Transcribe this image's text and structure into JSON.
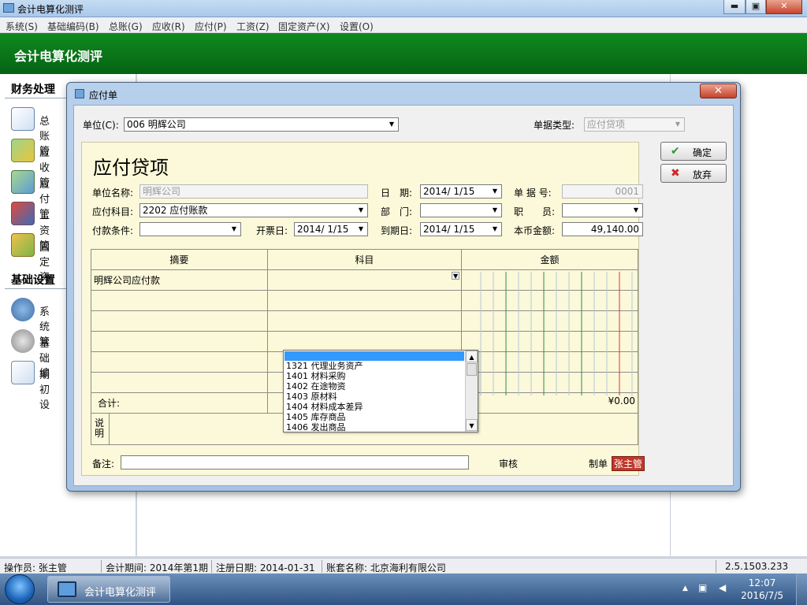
{
  "app": {
    "title": "会计电算化测评",
    "window_buttons": {
      "minimize": "▬",
      "restore": "▣",
      "close": "✕"
    }
  },
  "menu": [
    "系统(S)",
    "基础编码(B)",
    "总账(G)",
    "应收(R)",
    "应付(P)",
    "工资(Z)",
    "固定资产(X)",
    "设置(O)"
  ],
  "banner_title": "会计电算化测评",
  "sidebar": {
    "sections": [
      {
        "title": "财务处理",
        "items": [
          {
            "label": "总账管",
            "icon": "notepad-icon"
          },
          {
            "label": "应收管",
            "icon": "money-coins-icon"
          },
          {
            "label": "应付管",
            "icon": "money-arrows-icon"
          },
          {
            "label": "工资管",
            "icon": "id-card-icon"
          },
          {
            "label": "固定资",
            "icon": "basket-icon"
          }
        ]
      },
      {
        "title": "基础设置",
        "items": [
          {
            "label": "系统管",
            "icon": "gears-icon"
          },
          {
            "label": "基础编",
            "icon": "gear-icon"
          },
          {
            "label": "期初设",
            "icon": "spreadsheet-coins-icon"
          }
        ]
      }
    ]
  },
  "dialog": {
    "title": "应付单",
    "close_label": "✕",
    "unit_label": "单位(C):",
    "unit_value": "006 明辉公司",
    "doc_type_label": "单据类型:",
    "doc_type_value": "应付贷项",
    "confirm_label": "确定",
    "cancel_label": "放弃",
    "voucher": {
      "heading": "应付贷项",
      "fields": {
        "company_name_label": "单位名称:",
        "company_name_value": "明辉公司",
        "date_label": "日　期:",
        "date_value": "2014/ 1/15",
        "doc_no_label": "单 据 号:",
        "doc_no_value": "0001",
        "account_label": "应付科目:",
        "account_value": "2202 应付账款",
        "dept_label": "部　门:",
        "dept_value": "",
        "staff_label": "职　　员:",
        "staff_value": "",
        "payment_terms_label": "付款条件:",
        "payment_terms_value": "",
        "invoice_date_label": "开票日:",
        "invoice_date_value": "2014/ 1/15",
        "due_date_label": "到期日:",
        "due_date_value": "2014/ 1/15",
        "local_amount_label": "本币金额:",
        "local_amount_value": "49,140.00"
      },
      "table": {
        "headers": [
          "摘要",
          "科目",
          "金额"
        ],
        "rows": [
          {
            "summary": "明辉公司应付款",
            "subject": ""
          },
          {
            "summary": "",
            "subject": ""
          },
          {
            "summary": "",
            "subject": ""
          },
          {
            "summary": "",
            "subject": ""
          },
          {
            "summary": "",
            "subject": ""
          },
          {
            "summary": "",
            "subject": ""
          }
        ],
        "total_label": "合计:",
        "total_value": "¥0.00",
        "note_label": "说明"
      },
      "subject_options": [
        "",
        "1321  代理业务资产",
        "1401  材料采购",
        "1402  在途物资",
        "1403  原材料",
        "1404  材料成本差异",
        "1405  库存商品",
        "1406  发出商品"
      ],
      "remark_label": "备注:",
      "remark_value": "",
      "audit_label": "审核",
      "maker_label": "制单",
      "maker_value": "张主管"
    }
  },
  "background_panel_labels": {
    "tab_header": "应付管理",
    "right_header": "说明"
  },
  "status": {
    "operator": "操作员: 张主管",
    "period": "会计期间: 2014年第1期",
    "reg_date": "注册日期: 2014-01-31",
    "account_set": "账套名称: 北京海利有限公司",
    "version": "2.5.1503.233"
  },
  "taskbar": {
    "app_label": "会计电算化测评",
    "time": "12:07",
    "date": "2016/7/5"
  },
  "colors": {
    "banner_green": "#0a7a1a",
    "voucher_bg": "#fbf9d9",
    "maker_bg": "#c0392b",
    "selection": "#3399ff"
  }
}
